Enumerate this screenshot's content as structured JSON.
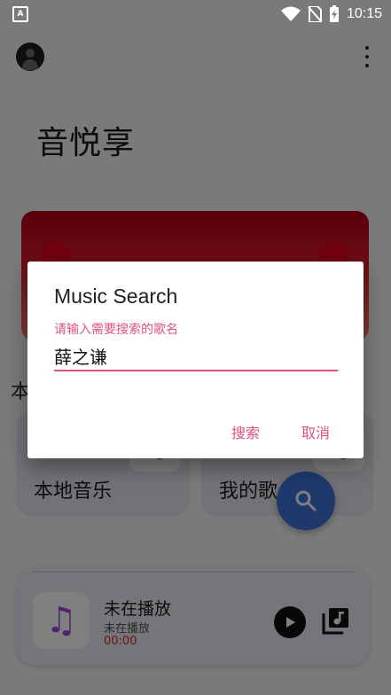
{
  "status_bar": {
    "app_badge": "A",
    "time": "10:15",
    "icons": [
      "wifi-icon",
      "no-sim-icon",
      "battery-charging-icon"
    ]
  },
  "header": {
    "title": "音悦享",
    "avatar_icon": "avatar-icon",
    "menu_icon": "more-vert-icon"
  },
  "section": {
    "partial_label": "本"
  },
  "cards": [
    {
      "label": "本地音乐",
      "icon": "music-note-icon"
    },
    {
      "label": "我的歌",
      "icon": "music-note-icon"
    }
  ],
  "fab": {
    "icon": "search-icon"
  },
  "player": {
    "title": "未在播放",
    "subtitle": "未在播放",
    "time": "00:00",
    "art_icon": "music-note-icon",
    "play_icon": "play-icon",
    "queue_icon": "queue-music-icon"
  },
  "dialog": {
    "title": "Music Search",
    "input_label": "请输入需要搜索的歌名",
    "input_value": "薛之谦",
    "search_button": "搜索",
    "cancel_button": "取消"
  },
  "colors": {
    "accent": "#e0517f",
    "fab": "#3c73d8",
    "time_red": "#d32f2f"
  }
}
